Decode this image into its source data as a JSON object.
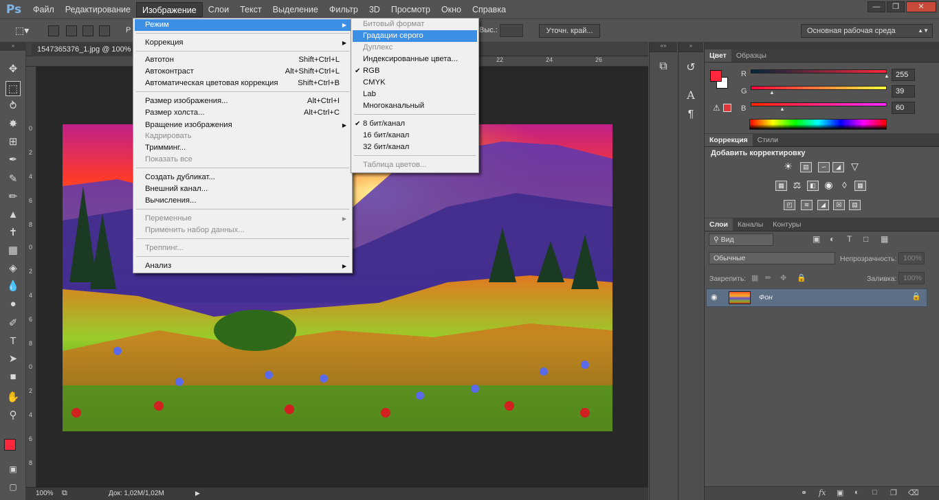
{
  "app": {
    "logo": "Ps"
  },
  "menubar": [
    "Файл",
    "Редактирование",
    "Изображение",
    "Слои",
    "Текст",
    "Выделение",
    "Фильтр",
    "3D",
    "Просмотр",
    "Окно",
    "Справка"
  ],
  "window_buttons": [
    "minimize-icon",
    "restore-icon",
    "close-icon"
  ],
  "options_bar": {
    "partial_label": "Р",
    "height_label": "Выс.:",
    "refine_edge": "Уточн. край...",
    "workspace": "Основная рабочая среда"
  },
  "document": {
    "tab_title": "1547365376_1.jpg @ 100% (",
    "ruler_top": [
      "22",
      "24",
      "26"
    ],
    "ruler_left": [
      "0",
      "2",
      "4",
      "6",
      "8",
      "0",
      "2",
      "4",
      "6",
      "8",
      "0",
      "2",
      "4",
      "6",
      "8"
    ],
    "zoom": "100%",
    "doc_info": "Док: 1,02М/1,02М"
  },
  "image_menu": {
    "items": [
      {
        "label": "Режим",
        "type": "submenu",
        "state": "highlight"
      },
      {
        "type": "sep"
      },
      {
        "label": "Коррекция",
        "type": "submenu"
      },
      {
        "type": "sep"
      },
      {
        "label": "Автотон",
        "shortcut": "Shift+Ctrl+L"
      },
      {
        "label": "Автоконтраст",
        "shortcut": "Alt+Shift+Ctrl+L"
      },
      {
        "label": "Автоматическая цветовая коррекция",
        "shortcut": "Shift+Ctrl+B"
      },
      {
        "type": "sep"
      },
      {
        "label": "Размер изображения...",
        "shortcut": "Alt+Ctrl+I"
      },
      {
        "label": "Размер холста...",
        "shortcut": "Alt+Ctrl+C"
      },
      {
        "label": "Вращение изображения",
        "type": "submenu"
      },
      {
        "label": "Кадрировать",
        "state": "disabled"
      },
      {
        "label": "Тримминг..."
      },
      {
        "label": "Показать все",
        "state": "disabled"
      },
      {
        "type": "sep"
      },
      {
        "label": "Создать дубликат..."
      },
      {
        "label": "Внешний канал..."
      },
      {
        "label": "Вычисления..."
      },
      {
        "type": "sep"
      },
      {
        "label": "Переменные",
        "type": "submenu",
        "state": "disabled"
      },
      {
        "label": "Применить набор данных...",
        "state": "disabled"
      },
      {
        "type": "sep"
      },
      {
        "label": "Треппинг...",
        "state": "disabled"
      },
      {
        "type": "sep"
      },
      {
        "label": "Анализ",
        "type": "submenu"
      }
    ]
  },
  "mode_submenu": {
    "items": [
      {
        "label": "Битовый формат",
        "state": "disabled"
      },
      {
        "label": "Градации серого",
        "state": "highlight"
      },
      {
        "label": "Дуплекс",
        "state": "disabled"
      },
      {
        "label": "Индексированные цвета..."
      },
      {
        "label": "RGB",
        "checked": true
      },
      {
        "label": "CMYK"
      },
      {
        "label": "Lab"
      },
      {
        "label": "Многоканальный"
      },
      {
        "type": "sep"
      },
      {
        "label": "8 бит/канал",
        "checked": true
      },
      {
        "label": "16 бит/канал"
      },
      {
        "label": "32 бит/канал"
      },
      {
        "type": "sep"
      },
      {
        "label": "Таблица цветов...",
        "state": "disabled"
      }
    ]
  },
  "color_panel": {
    "tabs": [
      "Цвет",
      "Образцы"
    ],
    "r_label": "R",
    "g_label": "G",
    "b_label": "B",
    "r": "255",
    "g": "39",
    "b": "60",
    "fg_color": "#ff273c"
  },
  "adjustments_panel": {
    "tabs": [
      "Коррекция",
      "Стили"
    ],
    "title": "Добавить корректировку"
  },
  "layers_panel": {
    "tabs": [
      "Слои",
      "Каналы",
      "Контуры"
    ],
    "filter": "Вид",
    "blend_mode": "Обычные",
    "opacity_label": "Непрозрачность:",
    "opacity": "100%",
    "lock_label": "Закрепить:",
    "fill_label": "Заливка:",
    "fill": "100%",
    "layer_name": "Фон"
  }
}
